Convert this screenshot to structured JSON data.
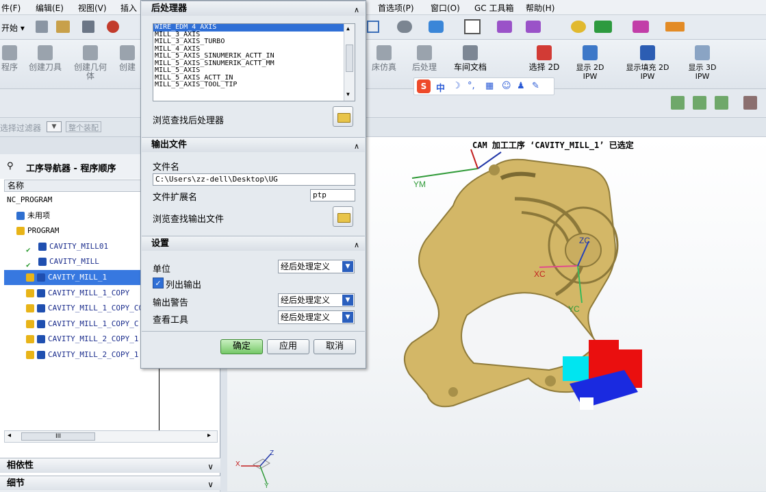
{
  "menubar": [
    "件(F)",
    "编辑(E)",
    "视图(V)",
    "插入",
    "首选项(P)",
    "窗口(O)",
    "GC 工具箱",
    "帮助(H)"
  ],
  "toolbar_start": "开始",
  "ribbon_left": [
    "程序",
    "创建刀具",
    "创建几何体",
    "创建"
  ],
  "ribbon_right": {
    "sim": "床仿真",
    "postprocess": "后处理",
    "shopdoc": "车间文档",
    "select2d": "选择 2D",
    "show2dipw": "显示 2D IPW",
    "fill2dipw": "显示填充 2D IPW",
    "show3dipw": "显示 3D IPW"
  },
  "filterbar": {
    "filter": "选择过滤器",
    "assembly": "整个装配"
  },
  "navigator": {
    "title": "工序导航器 - 程序顺序",
    "col_name": "名称",
    "rows": [
      {
        "text": "NC_PROGRAM",
        "indent": 0,
        "icon": "none",
        "sel": false
      },
      {
        "text": "未用项",
        "indent": 1,
        "icon": "folder",
        "sel": false
      },
      {
        "text": "PROGRAM",
        "indent": 1,
        "icon": "program",
        "sel": false
      },
      {
        "text": "CAVITY_MILL01",
        "indent": 2,
        "icon": "check",
        "sel": false
      },
      {
        "text": "CAVITY_MILL",
        "indent": 2,
        "icon": "check",
        "sel": false
      },
      {
        "text": "CAVITY_MILL_1",
        "indent": 2,
        "icon": "warn",
        "sel": true
      },
      {
        "text": "CAVITY_MILL_1_COPY",
        "indent": 2,
        "icon": "warn",
        "sel": false
      },
      {
        "text": "CAVITY_MILL_1_COPY_C0",
        "indent": 2,
        "icon": "warn",
        "sel": false
      },
      {
        "text": "CAVITY_MILL_1_COPY_C",
        "indent": 2,
        "icon": "warn",
        "sel": false
      },
      {
        "text": "CAVITY_MILL_2_COPY_1",
        "indent": 2,
        "icon": "warn",
        "sel": false
      },
      {
        "text": "CAVITY_MILL_2_COPY_1",
        "indent": 2,
        "icon": "warn",
        "sel": false
      }
    ],
    "hscroll_label": "III",
    "dependency": "相依性",
    "details": "细节"
  },
  "viewport_title": "CAM 加工工序 ‘CAVITY_MILL_1’ 已选定",
  "axes": {
    "ym": "YM",
    "xc": "XC",
    "yc": "YC",
    "zc": "ZC",
    "x": "X",
    "y": "Y",
    "z": "Z"
  },
  "dialog": {
    "sec_post": "后处理器",
    "post_list": [
      "WIRE_EDM_4_AXIS",
      "MILL_3_AXIS",
      "MILL_3_AXIS_TURBO",
      "MILL_4_AXIS",
      "MILL_5_AXIS_SINUMERIK_ACTT_IN",
      "MILL_5_AXIS_SINUMERIK_ACTT_MM",
      "MILL_5_AXIS",
      "MILL_5_AXIS_ACTT_IN",
      "MILL_5_AXIS_TOOL_TIP"
    ],
    "browse_post": "浏览查找后处理器",
    "sec_output": "输出文件",
    "filename_label": "文件名",
    "filename_value": "C:\\Users\\zz-dell\\Desktop\\UG",
    "ext_label": "文件扩展名",
    "ext_value": "ptp",
    "browse_output": "浏览查找输出文件",
    "sec_settings": "设置",
    "unit_label": "单位",
    "unit_value": "经后处理定义",
    "list_output": "列出输出",
    "warn_label": "输出警告",
    "warn_value": "经后处理定义",
    "tool_label": "查看工具",
    "tool_value": "经后处理定义",
    "ok": "确定",
    "apply": "应用",
    "cancel": "取消"
  },
  "ime": {
    "logo": "S",
    "lang": "中"
  }
}
